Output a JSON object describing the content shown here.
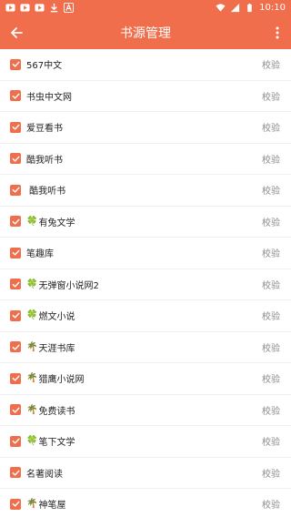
{
  "statusbar": {
    "time": "10:10",
    "icons_left": [
      "play-store-icon",
      "play-store-icon",
      "play-store-icon",
      "download-icon",
      "font-a-icon"
    ],
    "icons_right": [
      "wifi-icon",
      "signal-icon",
      "battery-icon"
    ]
  },
  "appbar": {
    "title": "书源管理",
    "back_icon": "arrow-left-icon",
    "more_icon": "more-vert-icon",
    "color": "#f06e4b"
  },
  "verify_label": "校验",
  "sources": [
    {
      "name": "567中文",
      "prefix": "",
      "checked": true
    },
    {
      "name": "书虫中文网",
      "prefix": "",
      "checked": true
    },
    {
      "name": "爱豆看书",
      "prefix": "",
      "checked": true
    },
    {
      "name": "酷我听书",
      "prefix": "",
      "checked": true
    },
    {
      "name": " 酷我听书",
      "prefix": "",
      "checked": true
    },
    {
      "name": "有兔文学",
      "prefix": "🍀",
      "checked": true
    },
    {
      "name": "笔趣库",
      "prefix": "",
      "checked": true
    },
    {
      "name": "无弹窗小说网2",
      "prefix": "🍀",
      "checked": true
    },
    {
      "name": "燃文小说",
      "prefix": "🍀",
      "checked": true
    },
    {
      "name": "天涯书库",
      "prefix": "🌴",
      "checked": true
    },
    {
      "name": "猎鹰小说网",
      "prefix": "🌴",
      "checked": true
    },
    {
      "name": "免费读书",
      "prefix": "🌴",
      "checked": true
    },
    {
      "name": "笔下文学",
      "prefix": "🍀",
      "checked": true
    },
    {
      "name": "名著阅读",
      "prefix": "",
      "checked": true
    },
    {
      "name": "神笔屋",
      "prefix": "🌴",
      "checked": true
    }
  ]
}
